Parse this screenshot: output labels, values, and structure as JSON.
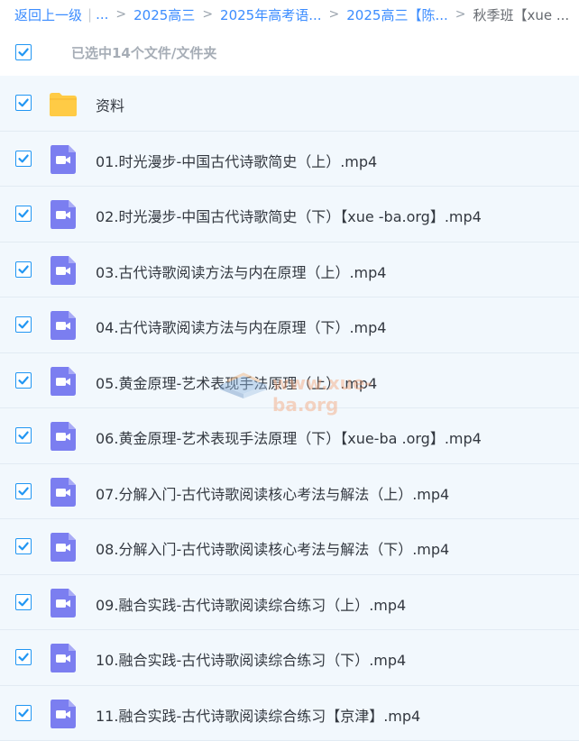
{
  "breadcrumb": {
    "back": "返回上一级",
    "ellipsis": "...",
    "items": [
      "2025高三",
      "2025年高考语...",
      "2025高三【陈...",
      "秋季班【xue ..."
    ],
    "separator": ">"
  },
  "selection": {
    "summary": "已选中14个文件/文件夹",
    "checked": true
  },
  "rows": [
    {
      "type": "folder",
      "name": "资料",
      "checked": true
    },
    {
      "type": "video",
      "name": "01.时光漫步-中国古代诗歌简史（上）.mp4",
      "checked": true
    },
    {
      "type": "video",
      "name": "02.时光漫步-中国古代诗歌简史（下）【xue -ba.org】.mp4",
      "checked": true
    },
    {
      "type": "video",
      "name": "03.古代诗歌阅读方法与内在原理（上）.mp4",
      "checked": true
    },
    {
      "type": "video",
      "name": "04.古代诗歌阅读方法与内在原理（下）.mp4",
      "checked": true
    },
    {
      "type": "video",
      "name": "05.黄金原理-艺术表现手法原理（上）.mp4",
      "checked": true
    },
    {
      "type": "video",
      "name": "06.黄金原理-艺术表现手法原理（下）【xue-ba .org】.mp4",
      "checked": true
    },
    {
      "type": "video",
      "name": "07.分解入门-古代诗歌阅读核心考法与解法（上）.mp4",
      "checked": true
    },
    {
      "type": "video",
      "name": "08.分解入门-古代诗歌阅读核心考法与解法（下）.mp4",
      "checked": true
    },
    {
      "type": "video",
      "name": "09.融合实践-古代诗歌阅读综合练习（上）.mp4",
      "checked": true
    },
    {
      "type": "video",
      "name": "10.融合实践-古代诗歌阅读综合练习（下）.mp4",
      "checked": true
    },
    {
      "type": "video",
      "name": "11.融合实践-古代诗歌阅读综合练习【京津】.mp4",
      "checked": true
    }
  ],
  "watermark": "www.xue-ba.org",
  "colors": {
    "accent": "#2196f3",
    "link": "#3b8cff",
    "row_bg": "#f2f8fd",
    "video_icon": "#7b7ef0",
    "folder_icon": "#ffcb45"
  }
}
